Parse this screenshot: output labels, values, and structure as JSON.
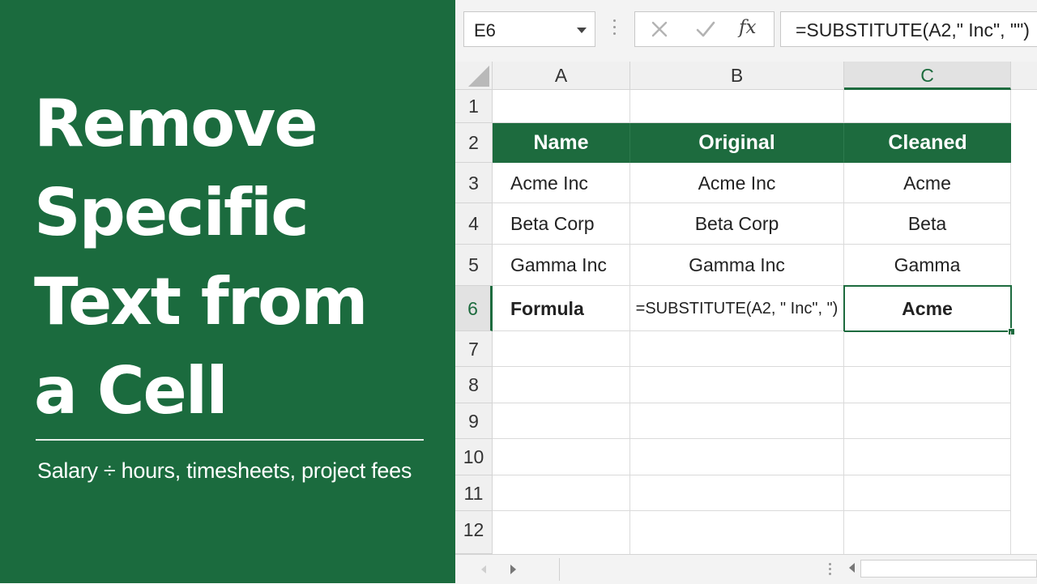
{
  "title_panel": {
    "lines": [
      "Remove",
      "Specific",
      "Text from",
      "a Cell"
    ],
    "subtitle": "Salary ÷ hours, timesheets, project fees",
    "background": "#1b6b3e"
  },
  "formula_bar": {
    "name_box": "E6",
    "formula": "=SUBSTITUTE(A2,\" Inc\", \"\")",
    "icons": [
      "chevron-down-icon",
      "cancel-icon",
      "enter-icon",
      "fx-icon"
    ]
  },
  "sheet": {
    "columns": [
      "A",
      "B",
      "C"
    ],
    "active_column": "C",
    "rows": [
      "1",
      "2",
      "3",
      "4",
      "5",
      "6",
      "7",
      "8",
      "9",
      "10",
      "11",
      "12"
    ],
    "active_row": "6",
    "selected_cell": "C6",
    "accent": "#1d6b3e",
    "table_header": [
      "Name",
      "Original",
      "Cleaned"
    ],
    "data_rows": [
      [
        "Acme Inc",
        "Acme Inc",
        "Acme"
      ],
      [
        "Beta Corp",
        "Beta Corp",
        "Beta"
      ],
      [
        "Gamma Inc",
        "Gamma Inc",
        "Gamma"
      ]
    ],
    "formula_row": [
      "Formula",
      "=SUBSTITUTE(A2, \" Inc\", \")",
      "Acme"
    ]
  }
}
